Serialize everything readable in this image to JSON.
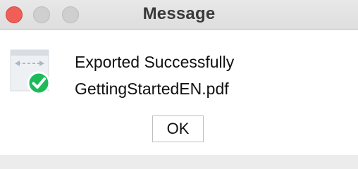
{
  "window": {
    "title": "Message"
  },
  "icons": {
    "document": "export-document-icon",
    "success": "checkmark-success-icon",
    "close": "close-window-control",
    "minimize": "minimize-window-control",
    "maximize": "maximize-window-control"
  },
  "message": {
    "line1": "Exported Successfully",
    "line2": "GettingStartedEN.pdf"
  },
  "buttons": {
    "ok": "OK"
  },
  "colors": {
    "close": "#ef5f58",
    "inactive_control": "#cfcfcf",
    "success": "#1dba5a",
    "background": "#ececec",
    "content": "#ffffff"
  }
}
